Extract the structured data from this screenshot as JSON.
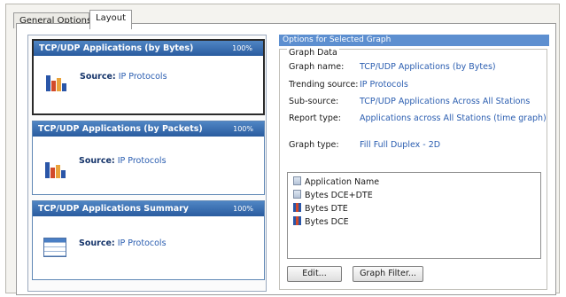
{
  "tabs": [
    {
      "label": "General Options"
    },
    {
      "label": "Layout"
    }
  ],
  "cards": [
    {
      "title": "TCP/UDP Applications (by Bytes)",
      "percent": "100%",
      "source_label": "Source:",
      "source_value": "IP Protocols",
      "icon": "bar-chart-icon"
    },
    {
      "title": "TCP/UDP Applications (by Packets)",
      "percent": "100%",
      "source_label": "Source:",
      "source_value": "IP Protocols",
      "icon": "bar-chart-icon"
    },
    {
      "title": "TCP/UDP Applications Summary",
      "percent": "100%",
      "source_label": "Source:",
      "source_value": "IP Protocols",
      "icon": "table-icon"
    }
  ],
  "options": {
    "header": "Options for Selected Graph",
    "group_title": "Graph Data",
    "fields": [
      {
        "label": "Graph name:",
        "value": "TCP/UDP Applications (by Bytes)"
      },
      {
        "label": "Trending source:",
        "value": "IP Protocols"
      },
      {
        "label": "Sub-source:",
        "value": "TCP/UDP Applications Across All Stations"
      },
      {
        "label": "Report type:",
        "value": "Applications across All Stations   (time graph)"
      },
      {
        "label": "Graph type:",
        "value": "Fill Full Duplex - 2D"
      }
    ],
    "list_items": [
      {
        "label": "Application Name",
        "icon": "document-icon"
      },
      {
        "label": "Bytes DCE+DTE",
        "icon": "document-icon"
      },
      {
        "label": "Bytes DTE",
        "icon": "bar-chart-icon"
      },
      {
        "label": "Bytes DCE",
        "icon": "bar-chart-icon"
      }
    ],
    "edit_button": "Edit...",
    "filter_button": "Graph Filter..."
  },
  "colors": {
    "card_header": "#2a5c9f",
    "section_header": "#5d8fd0",
    "value_text": "#2a5db0"
  }
}
